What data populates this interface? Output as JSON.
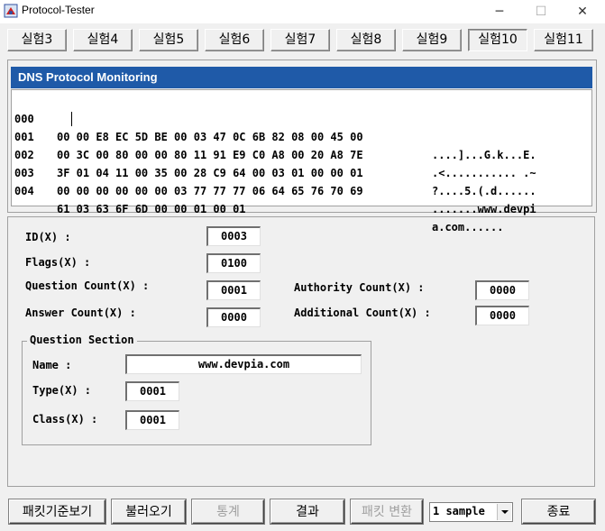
{
  "window": {
    "title": "Protocol-Tester",
    "min_glyph": "─",
    "max_glyph": "☐",
    "close_glyph": "✕"
  },
  "tabs": [
    "실험3",
    "실험4",
    "실험5",
    "실험6",
    "실험7",
    "실험8",
    "실험9",
    "실험10",
    "실험11"
  ],
  "active_tab": "실험10",
  "monitor": {
    "title": "DNS Protocol Monitoring",
    "rows": [
      {
        "offset": "000",
        "bytes": "00 00 E8 EC 5D BE 00 03 47 0C 6B 82 08 00 45 00",
        "ascii": "....]...G.k...E."
      },
      {
        "offset": "001",
        "bytes": "00 3C 00 80 00 00 80 11 91 E9 C0 A8 00 20 A8 7E",
        "ascii": ".<........... .~"
      },
      {
        "offset": "002",
        "bytes": "3F 01 04 11 00 35 00 28 C9 64 00 03 01 00 00 01",
        "ascii": "?....5.(.d......"
      },
      {
        "offset": "003",
        "bytes": "00 00 00 00 00 00 03 77 77 77 06 64 65 76 70 69",
        "ascii": ".......www.devpi"
      },
      {
        "offset": "004",
        "bytes": "61 03 63 6F 6D 00 00 01 00 01",
        "ascii": "a.com......"
      }
    ]
  },
  "fields": {
    "id_label": "ID(X) :",
    "id_value": "0003",
    "flags_label": "Flags(X) :",
    "flags_value": "0100",
    "question_count_label": "Question Count(X) :",
    "question_count_value": "0001",
    "answer_count_label": "Answer Count(X) :",
    "answer_count_value": "0000",
    "authority_count_label": "Authority Count(X) :",
    "authority_count_value": "0000",
    "additional_count_label": "Additional Count(X) :",
    "additional_count_value": "0000"
  },
  "question_section": {
    "title": "Question Section",
    "name_label": "Name :",
    "name_value": "www.devpia.com",
    "type_label": "Type(X) :",
    "type_value": "0001",
    "class_label": "Class(X) :",
    "class_value": "0001"
  },
  "buttons": {
    "packet_standard_view": "패킷기준보기",
    "load": "불러오기",
    "stats": "통계",
    "result": "결과",
    "packet_convert": "패킷 변환",
    "sample_select": "1 sample",
    "exit": "종료"
  }
}
